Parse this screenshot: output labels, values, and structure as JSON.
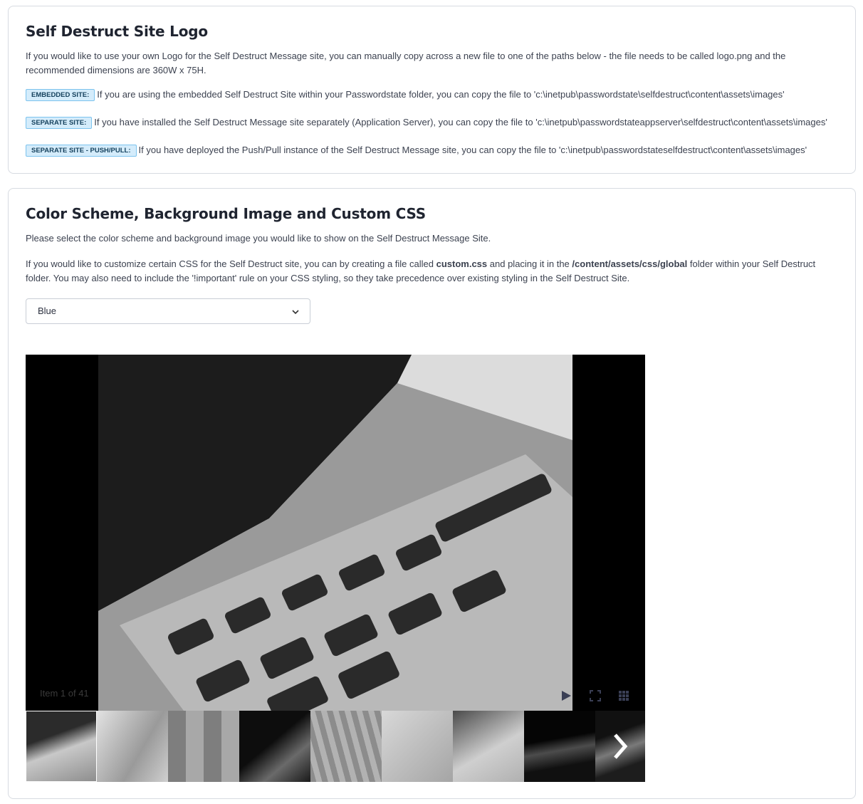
{
  "logo_section": {
    "title": "Self Destruct Site Logo",
    "intro": "If you would like to use your own Logo for the Self Destruct Message site, you can manually copy across a new file to one of the paths below - the file needs to be called logo.png and the recommended dimensions are 360W x 75H.",
    "items": [
      {
        "badge": "EMBEDDED SITE:",
        "text": "If you are using the embedded Self Destruct Site within your Passwordstate folder, you can copy the file to 'c:\\inetpub\\passwordstate\\selfdestruct\\content\\assets\\images'"
      },
      {
        "badge": "SEPARATE SITE:",
        "text": "If you have installed the Self Destruct Message site separately (Application Server), you can copy the file to 'c:\\inetpub\\passwordstateappserver\\selfdestruct\\content\\assets\\images'"
      },
      {
        "badge": "SEPARATE SITE - PUSH/PULL:",
        "text": "If you have deployed the Push/Pull instance of the Self Destruct Message site, you can copy the file to 'c:\\inetpub\\passwordstateselfdestruct\\content\\assets\\images'"
      }
    ]
  },
  "scheme_section": {
    "title": "Color Scheme, Background Image and Custom CSS",
    "intro": "Please select the color scheme and background image you would like to show on the Self Destruct Message Site.",
    "css_pre": "If you would like to customize certain CSS for the Self Destruct site, you can by creating a file called ",
    "css_file": "custom.css",
    "css_mid": " and placing it in the ",
    "css_folder": "/content/assets/css/global",
    "css_post": " folder within your Self Destruct folder. You may also need to include the '!important' rule on your CSS styling, so they take precedence over existing styling in the Self Destruct Site.",
    "color_select": {
      "selected": "Blue"
    },
    "gallery": {
      "counter": "Item 1 of 41",
      "icons": [
        "play-icon",
        "fullscreen-icon",
        "grid-icon",
        "next-arrow-icon"
      ],
      "thumb_count": 9
    }
  }
}
